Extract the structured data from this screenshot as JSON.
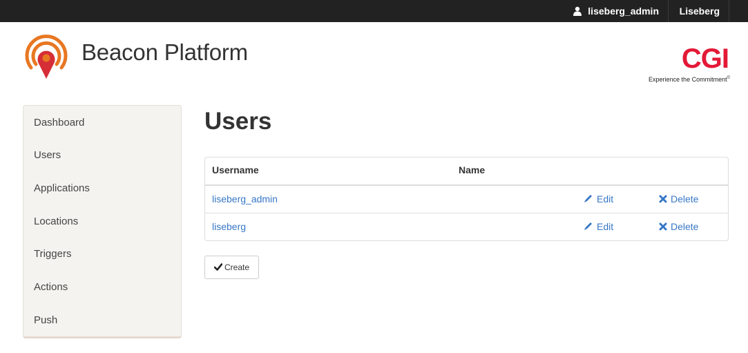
{
  "topbar": {
    "user_label": "liseberg_admin",
    "user_icon": "user-icon",
    "org_label": "Liseberg"
  },
  "header": {
    "logo_icon": "beacon-location-pin-icon",
    "brand_name": "Beacon Platform",
    "company_logo_text": "CGI",
    "company_tagline": "Experience the Commitment",
    "company_tagline_mark": "©"
  },
  "sidebar": {
    "items": [
      {
        "label": "Dashboard"
      },
      {
        "label": "Users"
      },
      {
        "label": "Applications"
      },
      {
        "label": "Locations"
      },
      {
        "label": "Triggers"
      },
      {
        "label": "Actions"
      },
      {
        "label": "Push"
      }
    ]
  },
  "main": {
    "title": "Users",
    "table": {
      "columns": [
        "Username",
        "Name"
      ],
      "rows": [
        {
          "username": "liseberg_admin",
          "name": "",
          "edit_label": "Edit",
          "delete_label": "Delete"
        },
        {
          "username": "liseberg",
          "name": "",
          "edit_label": "Edit",
          "delete_label": "Delete"
        }
      ]
    },
    "create_label": "Create"
  },
  "colors": {
    "topbar_bg": "#222222",
    "link": "#3677c6",
    "brand_red": "#e31937",
    "logo_orange": "#e87722",
    "sidebar_bg": "#f5f3ef"
  }
}
